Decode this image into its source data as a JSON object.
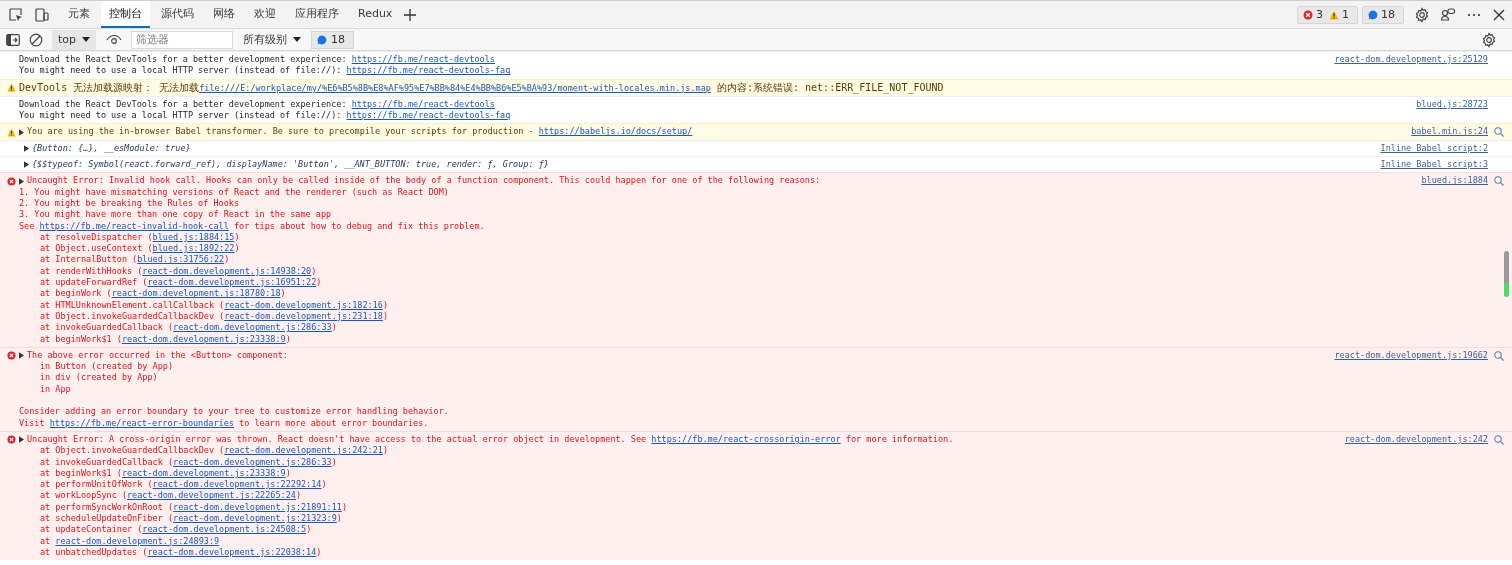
{
  "tabs": [
    {
      "label": "元素",
      "selected": false
    },
    {
      "label": "控制台",
      "selected": true
    },
    {
      "label": "源代码",
      "selected": false
    },
    {
      "label": "网络",
      "selected": false
    },
    {
      "label": "欢迎",
      "selected": false
    },
    {
      "label": "应用程序",
      "selected": false
    },
    {
      "label": "Redux",
      "selected": false
    }
  ],
  "counts": {
    "errors": "3",
    "warnings": "1",
    "messages": "18"
  },
  "toolbar": {
    "context_selector": {
      "value": "top"
    },
    "filter": {
      "placeholder": "筛选器"
    },
    "level_selector": {
      "value": "所有级别"
    },
    "issues_badge": "18"
  },
  "messages": [
    {
      "kind": "info",
      "expandable": false,
      "source": {
        "text": "react-dom.development.js:25129",
        "reveal": false
      },
      "lines": [
        {
          "kind": "plain",
          "parts": [
            {
              "kind": "text",
              "text": "Download the React DevTools for a better development experience: "
            },
            {
              "kind": "link",
              "text": "https://fb.me/react-devtools"
            }
          ]
        },
        {
          "kind": "plain",
          "parts": [
            {
              "kind": "text",
              "text": "You might need to use a local HTTP server (instead of file://): "
            },
            {
              "kind": "link",
              "text": "https://fb.me/react-devtools-faq"
            }
          ]
        }
      ]
    },
    {
      "kind": "warning",
      "expandable": false,
      "lines": [
        {
          "kind": "plain",
          "parts": [
            {
              "kind": "text",
              "text": "DevTools 无法加载源映射： 无法加载"
            },
            {
              "kind": "link",
              "text": "file:///E:/workplace/my/%E6%B5%8B%E8%AF%95%E7%BB%84%E4%BB%B6%E5%BA%93/moment-with-locales.min.js.map"
            },
            {
              "kind": "text",
              "text": " 的内容:系统错误: net::ERR_FILE_NOT_FOUND"
            }
          ]
        }
      ]
    },
    {
      "kind": "info",
      "expandable": false,
      "source": {
        "text": "blued.js:28723",
        "reveal": false
      },
      "lines": [
        {
          "kind": "plain",
          "parts": [
            {
              "kind": "text",
              "text": "Download the React DevTools for a better development experience: "
            },
            {
              "kind": "link",
              "text": "https://fb.me/react-devtools"
            }
          ]
        },
        {
          "kind": "plain",
          "parts": [
            {
              "kind": "text",
              "text": "You might need to use a local HTTP server (instead of file://): "
            },
            {
              "kind": "link",
              "text": "https://fb.me/react-devtools-faq"
            }
          ]
        }
      ]
    },
    {
      "kind": "warning",
      "expandable": true,
      "source": {
        "text": "babel.min.js:24",
        "reveal": true
      },
      "lines": [
        {
          "kind": "plain",
          "parts": [
            {
              "kind": "text",
              "text": "You are using the in-browser Babel transformer. Be sure to precompile your scripts for production - "
            },
            {
              "kind": "link",
              "text": "https://babeljs.io/docs/setup/"
            }
          ]
        }
      ]
    },
    {
      "kind": "info",
      "expandable": true,
      "source": {
        "text": "Inline Babel script:2",
        "reveal": false
      },
      "lines": [
        {
          "kind": "plain",
          "parts": [
            {
              "kind": "object",
              "text": "{Button: {…}, __esModule: true}"
            }
          ]
        }
      ]
    },
    {
      "kind": "info",
      "expandable": true,
      "source": {
        "text": "Inline Babel script:3",
        "reveal": false
      },
      "lines": [
        {
          "kind": "plain",
          "parts": [
            {
              "kind": "object",
              "text": "{$$typeof: Symbol(react.forward_ref), displayName: 'Button', __ANT_BUTTON: true, render: ƒ, Group: ƒ}"
            }
          ]
        }
      ]
    },
    {
      "kind": "error",
      "expandable": true,
      "source": {
        "text": "blued.js:1884",
        "reveal": true
      },
      "lines": [
        {
          "kind": "plain",
          "parts": [
            {
              "kind": "text",
              "text": "Uncaught Error: Invalid hook call. Hooks can only be called inside of the body of a function component. This could happen for one of the following reasons:"
            }
          ]
        },
        {
          "kind": "plain",
          "parts": [
            {
              "kind": "text",
              "text": "1. You might have mismatching versions of React and the renderer (such as React DOM)"
            }
          ]
        },
        {
          "kind": "plain",
          "parts": [
            {
              "kind": "text",
              "text": "2. You might be breaking the Rules of Hooks"
            }
          ]
        },
        {
          "kind": "plain",
          "parts": [
            {
              "kind": "text",
              "text": "3. You might have more than one copy of React in the same app"
            }
          ]
        },
        {
          "kind": "plain",
          "parts": [
            {
              "kind": "text",
              "text": "See "
            },
            {
              "kind": "link",
              "text": "https://fb.me/react-invalid-hook-call"
            },
            {
              "kind": "text",
              "text": " for tips about how to debug and fix this problem."
            }
          ]
        },
        {
          "kind": "frame",
          "parts": [
            {
              "kind": "text",
              "text": "at resolveDispatcher ("
            },
            {
              "kind": "link",
              "text": "blued.js:1884:15"
            },
            {
              "kind": "text",
              "text": ")"
            }
          ]
        },
        {
          "kind": "frame",
          "parts": [
            {
              "kind": "text",
              "text": "at Object.useContext ("
            },
            {
              "kind": "link",
              "text": "blued.js:1892:22"
            },
            {
              "kind": "text",
              "text": ")"
            }
          ]
        },
        {
          "kind": "frame",
          "parts": [
            {
              "kind": "text",
              "text": "at InternalButton ("
            },
            {
              "kind": "link",
              "text": "blued.js:31756:22"
            },
            {
              "kind": "text",
              "text": ")"
            }
          ]
        },
        {
          "kind": "frame",
          "parts": [
            {
              "kind": "text",
              "text": "at renderWithHooks ("
            },
            {
              "kind": "link",
              "text": "react-dom.development.js:14938:20"
            },
            {
              "kind": "text",
              "text": ")"
            }
          ]
        },
        {
          "kind": "frame",
          "parts": [
            {
              "kind": "text",
              "text": "at updateForwardRef ("
            },
            {
              "kind": "link",
              "text": "react-dom.development.js:16951:22"
            },
            {
              "kind": "text",
              "text": ")"
            }
          ]
        },
        {
          "kind": "frame",
          "parts": [
            {
              "kind": "text",
              "text": "at beginWork ("
            },
            {
              "kind": "link",
              "text": "react-dom.development.js:18780:18"
            },
            {
              "kind": "text",
              "text": ")"
            }
          ]
        },
        {
          "kind": "frame",
          "parts": [
            {
              "kind": "text",
              "text": "at HTMLUnknownElement.callCallback ("
            },
            {
              "kind": "link",
              "text": "react-dom.development.js:182:16"
            },
            {
              "kind": "text",
              "text": ")"
            }
          ]
        },
        {
          "kind": "frame",
          "parts": [
            {
              "kind": "text",
              "text": "at Object.invokeGuardedCallbackDev ("
            },
            {
              "kind": "link",
              "text": "react-dom.development.js:231:18"
            },
            {
              "kind": "text",
              "text": ")"
            }
          ]
        },
        {
          "kind": "frame",
          "parts": [
            {
              "kind": "text",
              "text": "at invokeGuardedCallback ("
            },
            {
              "kind": "link",
              "text": "react-dom.development.js:286:33"
            },
            {
              "kind": "text",
              "text": ")"
            }
          ]
        },
        {
          "kind": "frame",
          "parts": [
            {
              "kind": "text",
              "text": "at beginWork$1 ("
            },
            {
              "kind": "link",
              "text": "react-dom.development.js:23338:9"
            },
            {
              "kind": "text",
              "text": ")"
            }
          ]
        }
      ]
    },
    {
      "kind": "error",
      "expandable": true,
      "source": {
        "text": "react-dom.development.js:19662",
        "reveal": true
      },
      "lines": [
        {
          "kind": "plain",
          "parts": [
            {
              "kind": "text",
              "text": "The above error occurred in the <Button> component:"
            }
          ]
        },
        {
          "kind": "frame",
          "parts": [
            {
              "kind": "text",
              "text": "in Button (created by App)"
            }
          ]
        },
        {
          "kind": "frame",
          "parts": [
            {
              "kind": "text",
              "text": "in div (created by App)"
            }
          ]
        },
        {
          "kind": "frame",
          "parts": [
            {
              "kind": "text",
              "text": "in App"
            }
          ]
        },
        {
          "kind": "blank"
        },
        {
          "kind": "plain",
          "parts": [
            {
              "kind": "text",
              "text": "Consider adding an error boundary to your tree to customize error handling behavior."
            }
          ]
        },
        {
          "kind": "plain",
          "parts": [
            {
              "kind": "text",
              "text": "Visit "
            },
            {
              "kind": "link",
              "text": "https://fb.me/react-error-boundaries"
            },
            {
              "kind": "text",
              "text": " to learn more about error boundaries."
            }
          ]
        }
      ]
    },
    {
      "kind": "error",
      "expandable": true,
      "source": {
        "text": "react-dom.development.js:242",
        "reveal": true
      },
      "lines": [
        {
          "kind": "plain",
          "parts": [
            {
              "kind": "text",
              "text": "Uncaught Error: A cross-origin error was thrown. React doesn't have access to the actual error object in development. See "
            },
            {
              "kind": "link",
              "text": "https://fb.me/react-crossorigin-error"
            },
            {
              "kind": "text",
              "text": " for more information."
            }
          ]
        },
        {
          "kind": "frame",
          "parts": [
            {
              "kind": "text",
              "text": "at Object.invokeGuardedCallbackDev ("
            },
            {
              "kind": "link",
              "text": "react-dom.development.js:242:21"
            },
            {
              "kind": "text",
              "text": ")"
            }
          ]
        },
        {
          "kind": "frame",
          "parts": [
            {
              "kind": "text",
              "text": "at invokeGuardedCallback ("
            },
            {
              "kind": "link",
              "text": "react-dom.development.js:286:33"
            },
            {
              "kind": "text",
              "text": ")"
            }
          ]
        },
        {
          "kind": "frame",
          "parts": [
            {
              "kind": "text",
              "text": "at beginWork$1 ("
            },
            {
              "kind": "link",
              "text": "react-dom.development.js:23338:9"
            },
            {
              "kind": "text",
              "text": ")"
            }
          ]
        },
        {
          "kind": "frame",
          "parts": [
            {
              "kind": "text",
              "text": "at performUnitOfWork ("
            },
            {
              "kind": "link",
              "text": "react-dom.development.js:22292:14"
            },
            {
              "kind": "text",
              "text": ")"
            }
          ]
        },
        {
          "kind": "frame",
          "parts": [
            {
              "kind": "text",
              "text": "at workLoopSync ("
            },
            {
              "kind": "link",
              "text": "react-dom.development.js:22265:24"
            },
            {
              "kind": "text",
              "text": ")"
            }
          ]
        },
        {
          "kind": "frame",
          "parts": [
            {
              "kind": "text",
              "text": "at performSyncWorkOnRoot ("
            },
            {
              "kind": "link",
              "text": "react-dom.development.js:21891:11"
            },
            {
              "kind": "text",
              "text": ")"
            }
          ]
        },
        {
          "kind": "frame",
          "parts": [
            {
              "kind": "text",
              "text": "at scheduleUpdateOnFiber ("
            },
            {
              "kind": "link",
              "text": "react-dom.development.js:21323:9"
            },
            {
              "kind": "text",
              "text": ")"
            }
          ]
        },
        {
          "kind": "frame",
          "parts": [
            {
              "kind": "text",
              "text": "at updateContainer ("
            },
            {
              "kind": "link",
              "text": "react-dom.development.js:24508:5"
            },
            {
              "kind": "text",
              "text": ")"
            }
          ]
        },
        {
          "kind": "frame",
          "parts": [
            {
              "kind": "text",
              "text": "at "
            },
            {
              "kind": "link",
              "text": "react-dom.development.js:24893:9"
            }
          ]
        },
        {
          "kind": "frame",
          "parts": [
            {
              "kind": "text",
              "text": "at unbatchedUpdates ("
            },
            {
              "kind": "link",
              "text": "react-dom.development.js:22038:14"
            },
            {
              "kind": "text",
              "text": ")"
            }
          ]
        }
      ]
    }
  ]
}
